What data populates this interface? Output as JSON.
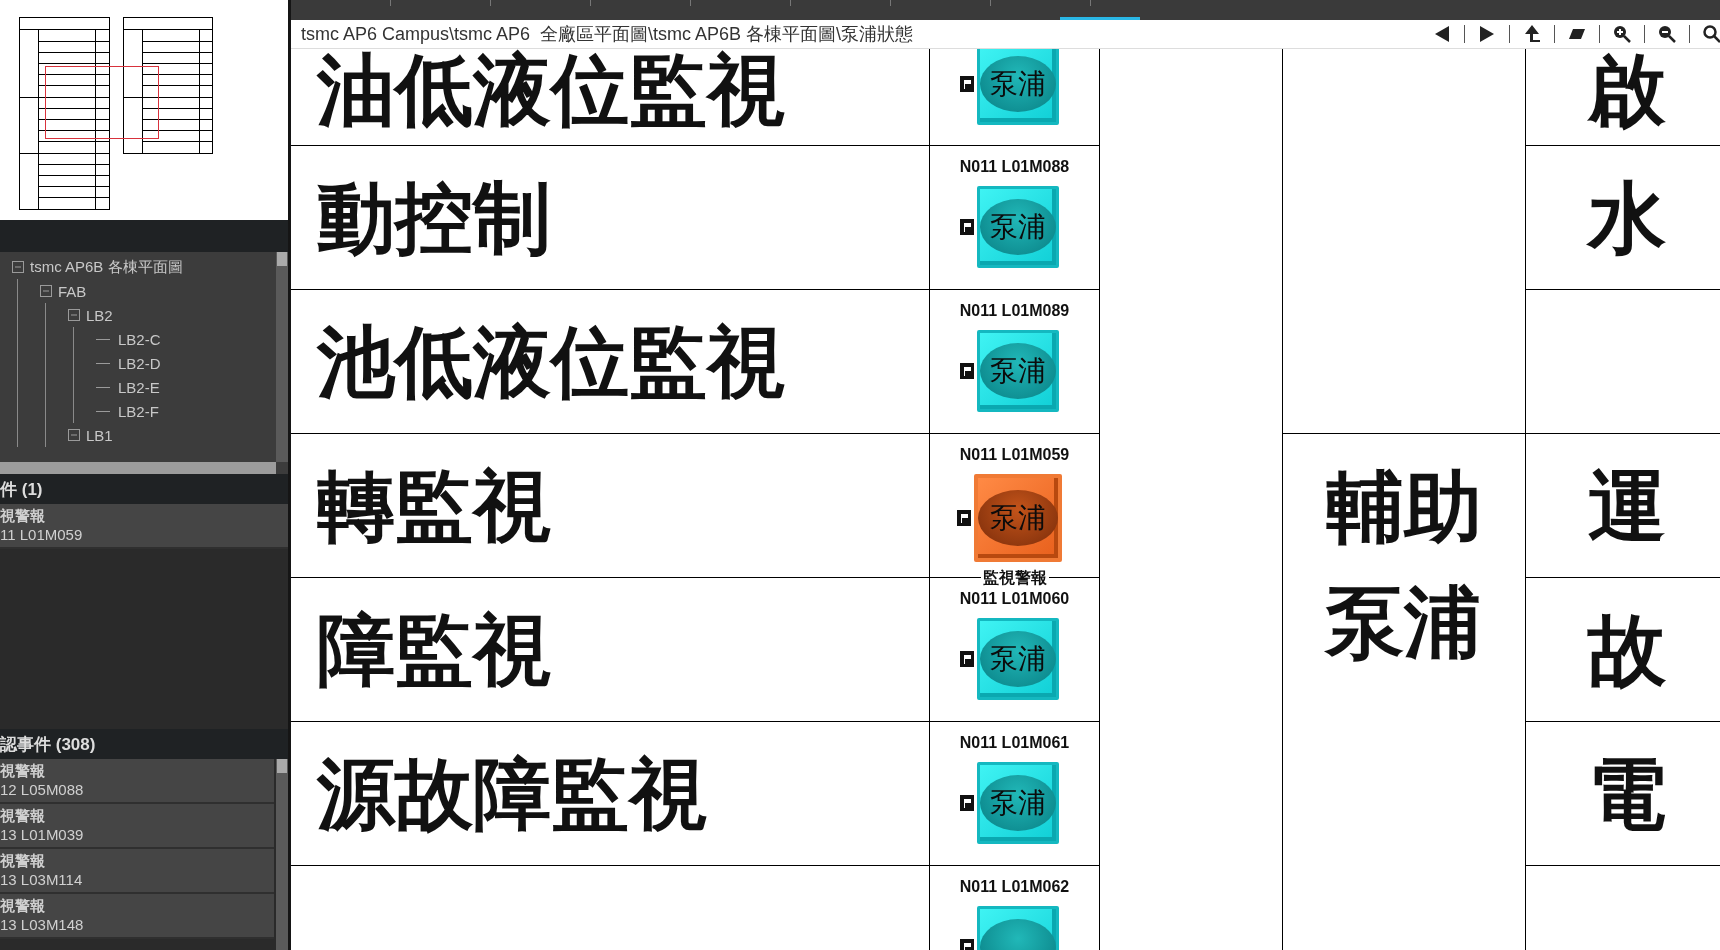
{
  "sidebar": {
    "tree": [
      {
        "label": "tsmc AP6B 各棟平面圖",
        "expanded": true,
        "children": [
          {
            "label": "FAB",
            "expanded": true,
            "children": [
              {
                "label": "LB2",
                "expanded": true,
                "children": [
                  {
                    "label": "LB2-C"
                  },
                  {
                    "label": "LB2-D"
                  },
                  {
                    "label": "LB2-E"
                  },
                  {
                    "label": "LB2-F"
                  }
                ]
              },
              {
                "label": "LB1",
                "expanded": true
              }
            ]
          }
        ]
      }
    ],
    "active_events": {
      "title": "件 (1)",
      "events": [
        {
          "type": "視警報",
          "device": "11 L01M059"
        }
      ]
    },
    "unacked_events": {
      "title": "認事件 (308)",
      "events": [
        {
          "type": "視警報",
          "device": "12 L05M088"
        },
        {
          "type": "視警報",
          "device": "13 L01M039"
        },
        {
          "type": "視警報",
          "device": "13 L03M114"
        },
        {
          "type": "視警報",
          "device": "13 L03M148"
        }
      ]
    }
  },
  "path_bar": {
    "path": "tsmc AP6 Campus\\tsmc AP6  全廠區平面圖\\tsmc AP6B 各棟平面圖\\泵浦狀態"
  },
  "board": {
    "groups": [
      {
        "rows": [
          {
            "label": "油低液位監視",
            "pump": {
              "label": "泵浦",
              "alarm": false
            },
            "side": "啟"
          },
          {
            "label": "動控制",
            "device": "N011 L01M088",
            "pump": {
              "label": "泵浦",
              "alarm": false
            },
            "side": "水"
          },
          {
            "label": "池低液位監視",
            "device": "N011 L01M089",
            "pump": {
              "label": "泵浦",
              "alarm": false
            }
          }
        ]
      },
      {
        "label": "輔助泵浦",
        "rows": [
          {
            "label": "轉監視",
            "device": "N011 L01M059",
            "pump": {
              "label": "泵浦",
              "alarm": true,
              "status": "監視警報"
            },
            "side": "運"
          },
          {
            "label": "障監視",
            "device": "N011 L01M060",
            "pump": {
              "label": "泵浦",
              "alarm": false
            },
            "side": "故"
          },
          {
            "label": "源故障監視",
            "device": "N011 L01M061",
            "pump": {
              "label": "泵浦",
              "alarm": false
            },
            "side": "電"
          },
          {
            "device": "N011 L01M062",
            "pump": {
              "alarm": false
            }
          }
        ]
      }
    ]
  }
}
